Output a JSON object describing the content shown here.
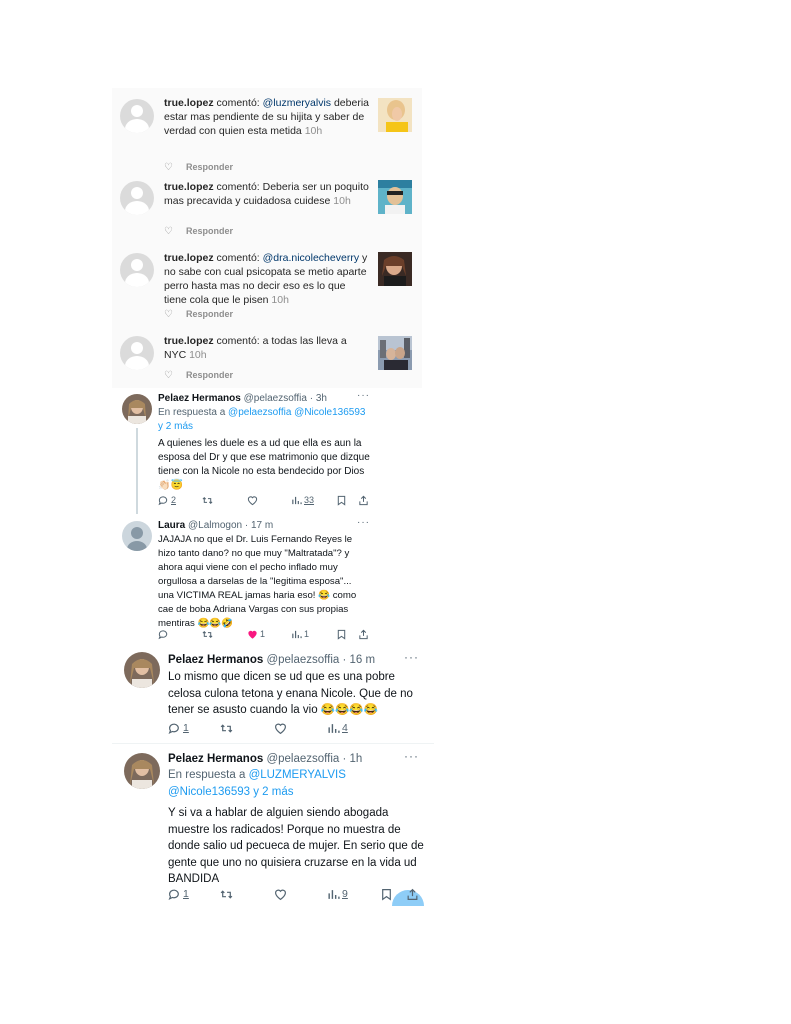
{
  "instagram": {
    "comments": [
      {
        "user": "true.lopez",
        "verb": " comentó: ",
        "mention": "@luzmeryalvis",
        "text": " deberia estar mas pendiente de su hijita y saber de verdad con quien esta metida",
        "time": "10h",
        "reply": "Responder"
      },
      {
        "user": "true.lopez",
        "verb": " comentó: ",
        "mention": "",
        "text": "Deberia ser un poquito mas precavida y cuidadosa cuidese",
        "time": "10h",
        "reply": "Responder"
      },
      {
        "user": "true.lopez",
        "verb": " comentó: ",
        "mention": "@dra.nicolecheverry",
        "text": " y no sabe con cual psicopata se metio aparte perro hasta mas no decir eso es lo que tiene cola que le pisen",
        "time": "10h",
        "reply": "Responder"
      },
      {
        "user": "true.lopez",
        "verb": " comentó: ",
        "mention": "",
        "text": "a todas las lleva a NYC",
        "time": "10h",
        "reply": "Responder"
      }
    ]
  },
  "tweets": [
    {
      "name": "Pelaez Hermanos",
      "handle": "@pelaezsoffia",
      "sep": " · ",
      "time": "3h",
      "reply_prefix": "En respuesta a ",
      "reply_to": "@pelaezsoffia @Nicole136593",
      "reply_more": "y 2 más",
      "text": "A quienes les duele es a ud que ella es aun la esposa del Dr y que ese matrimonio que dizque tiene con la Nicole no esta bendecido por Dios 👏🏻😇",
      "replies": "2",
      "retweets": "",
      "likes": "",
      "views": "33"
    },
    {
      "name": "Laura",
      "handle": "@Lalmogon",
      "sep": " · ",
      "time": "17 m",
      "text": "JAJAJA no que el Dr. Luis Fernando Reyes le hizo tanto dano? no que muy \"Maltratada\"? y ahora aqui viene con el pecho inflado muy orgullosa a darselas de la \"legitima esposa\"... una VICTIMA REAL jamas haria eso! 😂 como cae de boba Adriana Vargas con sus propias mentiras 😂😂🤣",
      "replies": "",
      "retweets": "",
      "likes": "1",
      "views": "1"
    },
    {
      "name": "Pelaez Hermanos",
      "handle": "@pelaezsoffia",
      "sep": " · ",
      "time": "16 m",
      "text": "Lo mismo que dicen se ud que es una pobre celosa culona tetona y enana Nicole. Que de no tener se asusto cuando la vio 😂😂😂😂",
      "replies": "1",
      "retweets": "",
      "likes": "",
      "views": "4"
    },
    {
      "name": "Pelaez Hermanos",
      "handle": "@pelaezsoffia",
      "sep": " · ",
      "time": "1h",
      "reply_prefix": "En respuesta a ",
      "reply_to": "@LUZMERYALVIS @Nicole136593",
      "reply_more": "y 2 más",
      "text": "Y si va a hablar de alguien siendo abogada muestre los radicados! Porque no muestra de donde salio ud pecueca de mujer. En serio que de gente que uno no quisiera cruzarse en la vida ud BANDIDA",
      "replies": "1",
      "retweets": "",
      "likes": "",
      "views": "9"
    }
  ],
  "colors": {
    "link": "#1d9bf0",
    "muted": "#536471",
    "like_active": "#f91880"
  }
}
